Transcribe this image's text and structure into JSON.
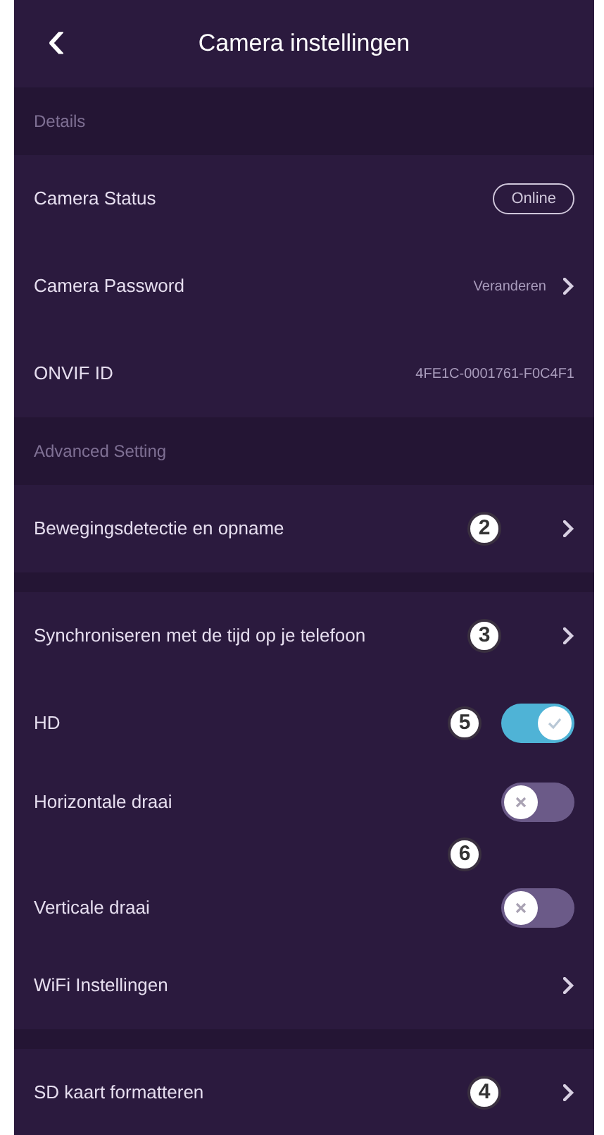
{
  "header": {
    "back": "‹",
    "title": "Camera instellingen"
  },
  "sections": [
    {
      "title": "Details",
      "rows": [
        {
          "kind": "badge",
          "label": "Camera Status",
          "value": "Online"
        },
        {
          "kind": "link",
          "label": "Camera Password",
          "value": "Veranderen"
        },
        {
          "kind": "text",
          "label": "ONVIF ID",
          "value": "4FE1C-0001761-F0C4F1"
        }
      ]
    },
    {
      "title": "Advanced Setting",
      "rows": [
        {
          "kind": "link",
          "label": "Bewegingsdetectie en opname",
          "marker": "2",
          "gap_after": true
        },
        {
          "kind": "link",
          "label": "Synchroniseren met de tijd op je telefoon",
          "marker": "3"
        },
        {
          "kind": "toggle",
          "label": "HD",
          "on": true,
          "marker": "5"
        },
        {
          "kind": "toggle",
          "label": "Horizontale draai",
          "on": false,
          "marker": "6",
          "marker_spans_next": true
        },
        {
          "kind": "toggle",
          "label": "Verticale draai",
          "on": false
        },
        {
          "kind": "link",
          "label": "WiFi Instellingen",
          "gap_after": true
        },
        {
          "kind": "link",
          "label": "SD kaart formatteren",
          "marker": "4"
        }
      ]
    }
  ]
}
